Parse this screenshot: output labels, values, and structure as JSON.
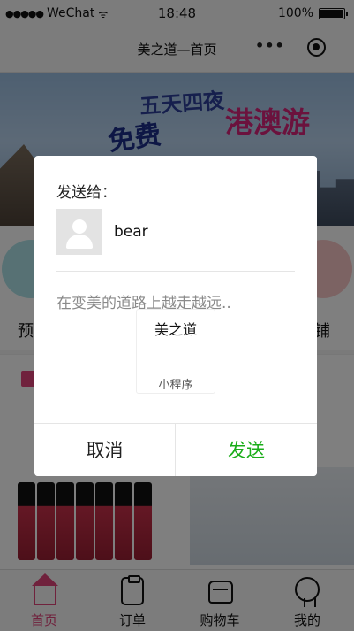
{
  "status_bar": {
    "signal": "●●●●●",
    "carrier": "WeChat",
    "wifi": "ᯤ",
    "time": "18:48",
    "battery_percent": "100%",
    "battery_level": 1.0
  },
  "nav": {
    "title": "美之道—首页",
    "more_icon": "•••"
  },
  "banner": {
    "line1": "五天四夜",
    "line2": "港澳游",
    "line3": "免费"
  },
  "categories": [
    {
      "label": "预"
    },
    {
      "label": "铺"
    }
  ],
  "tabs": [
    {
      "label": "首页",
      "icon": "home-icon",
      "active": true
    },
    {
      "label": "订单",
      "icon": "order-icon",
      "active": false
    },
    {
      "label": "购物车",
      "icon": "cart-icon",
      "active": false
    },
    {
      "label": "我的",
      "icon": "user-icon",
      "active": false
    }
  ],
  "dialog": {
    "heading": "发送给：",
    "recipient": {
      "name": "bear",
      "avatar_icon": "default-avatar-icon"
    },
    "message": "在变美的道路上越走越远..",
    "card": {
      "title": "美之道",
      "tag": "小程序"
    },
    "cancel_label": "取消",
    "send_label": "发送"
  },
  "colors": {
    "accent": "#e0457b",
    "send": "#1aad19",
    "overlay": "rgba(0,0,0,0.5)"
  }
}
